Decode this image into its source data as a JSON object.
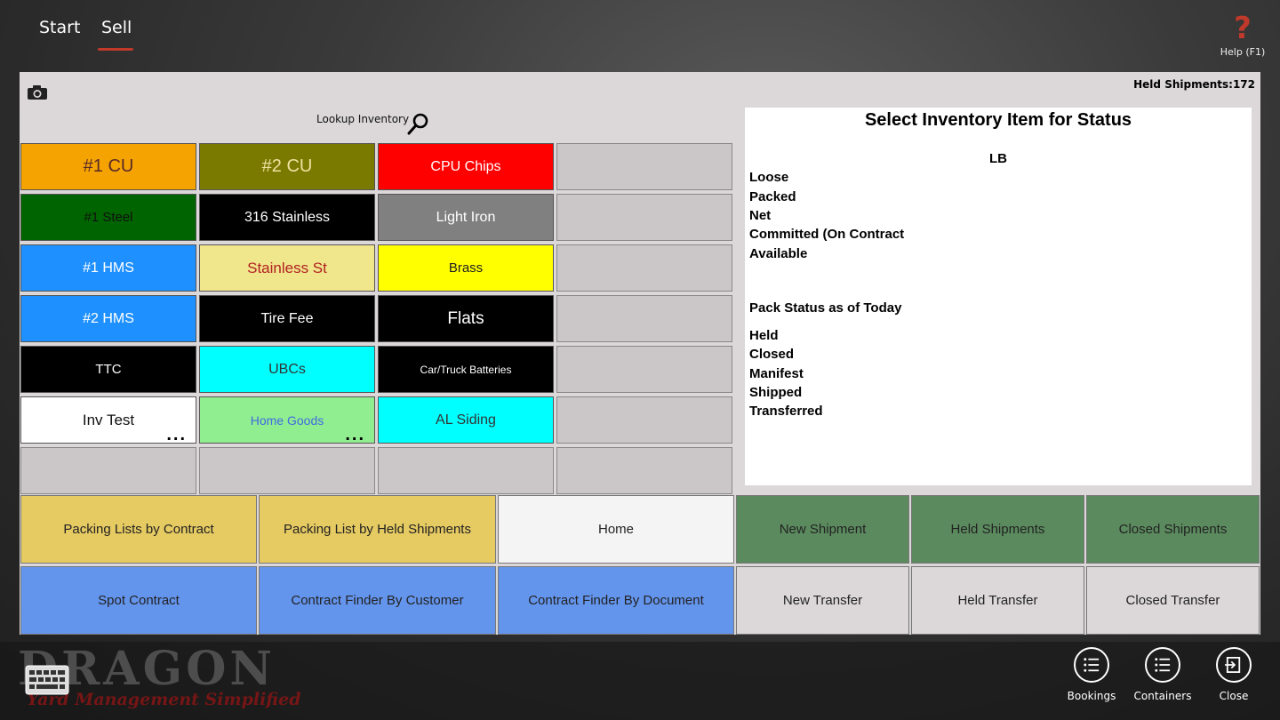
{
  "nav": {
    "tabs": [
      "Start",
      "Sell"
    ],
    "active": "Sell",
    "help_label": "Help (F1)",
    "help_glyph": "?"
  },
  "toolbar": {
    "held_shipments": "Held Shipments:172",
    "lookup_label": "Lookup Inventory"
  },
  "inventory": [
    {
      "label": "#1 CU",
      "bg": "#f5a300",
      "fg": "#5a2a2a",
      "size": 20
    },
    {
      "label": "#2 CU",
      "bg": "#7a7a00",
      "fg": "#f0e0a0",
      "size": 20
    },
    {
      "label": "CPU Chips",
      "bg": "#ff0000",
      "fg": "#ffffff",
      "size": 16
    },
    {
      "label": "",
      "bg": "",
      "fg": ""
    },
    {
      "label": "#1 Steel",
      "bg": "#006400",
      "fg": "#111111",
      "size": 15
    },
    {
      "label": "316 Stainless",
      "bg": "#000000",
      "fg": "#ffffff",
      "size": 16
    },
    {
      "label": "Light Iron",
      "bg": "#808080",
      "fg": "#ffffff",
      "size": 16
    },
    {
      "label": "",
      "bg": "",
      "fg": ""
    },
    {
      "label": "#1 HMS",
      "bg": "#1e90ff",
      "fg": "#ffffff",
      "size": 16
    },
    {
      "label": "Stainless St",
      "bg": "#f0e68c",
      "fg": "#b22222",
      "size": 17
    },
    {
      "label": "Brass",
      "bg": "#ffff00",
      "fg": "#222222",
      "size": 15
    },
    {
      "label": "",
      "bg": "",
      "fg": ""
    },
    {
      "label": "#2 HMS",
      "bg": "#1e90ff",
      "fg": "#ffffff",
      "size": 16
    },
    {
      "label": "Tire Fee",
      "bg": "#000000",
      "fg": "#ffffff",
      "size": 16
    },
    {
      "label": "Flats",
      "bg": "#000000",
      "fg": "#ffffff",
      "size": 19
    },
    {
      "label": "",
      "bg": "",
      "fg": ""
    },
    {
      "label": "TTC",
      "bg": "#000000",
      "fg": "#ffffff",
      "size": 15
    },
    {
      "label": "UBCs",
      "bg": "#00ffff",
      "fg": "#333333",
      "size": 16
    },
    {
      "label": "Car/Truck Batteries",
      "bg": "#000000",
      "fg": "#ffffff",
      "size": 12
    },
    {
      "label": "",
      "bg": "",
      "fg": ""
    },
    {
      "label": "Inv Test",
      "bg": "#ffffff",
      "fg": "#111111",
      "size": 17,
      "more": "..."
    },
    {
      "label": "Home Goods",
      "bg": "#90ee90",
      "fg": "#4169e1",
      "size": 14,
      "more": "..."
    },
    {
      "label": "AL Siding",
      "bg": "#00ffff",
      "fg": "#333333",
      "size": 16
    },
    {
      "label": "",
      "bg": "",
      "fg": ""
    },
    {
      "label": "",
      "bg": "",
      "fg": ""
    },
    {
      "label": "",
      "bg": "",
      "fg": ""
    },
    {
      "label": "",
      "bg": "",
      "fg": ""
    },
    {
      "label": "",
      "bg": "",
      "fg": ""
    }
  ],
  "status": {
    "title": "Select Inventory Item for Status",
    "unit": "LB",
    "qty_rows": [
      "Loose",
      "Packed",
      "Net",
      "Committed (On Contract",
      "Available"
    ],
    "pack_header": "Pack Status as of Today",
    "pack_rows": [
      "Held",
      "Closed",
      "Manifest",
      "Shipped",
      "Transferred"
    ]
  },
  "actions": {
    "packing_by_contract": "Packing Lists by Contract",
    "packing_by_held": "Packing List by Held Shipments",
    "home": "Home",
    "new_shipment": "New Shipment",
    "held_shipments": "Held Shipments",
    "closed_shipments": "Closed Shipments",
    "spot_contract": "Spot Contract",
    "finder_customer": "Contract Finder By Customer",
    "finder_document": "Contract Finder By Document",
    "new_transfer": "New Transfer",
    "held_transfer": "Held Transfer",
    "closed_transfer": "Closed Transfer"
  },
  "colors": {
    "yellow": "#e6ca62",
    "blue": "#6495ed",
    "green": "#5b8a5e",
    "white": "#f4f4f4",
    "gray": "#dcd8d9"
  },
  "branding": {
    "logo": "DRAGON",
    "tagline": "Yard Management Simplified"
  },
  "appbar": {
    "bookings": "Bookings",
    "containers": "Containers",
    "close": "Close"
  }
}
